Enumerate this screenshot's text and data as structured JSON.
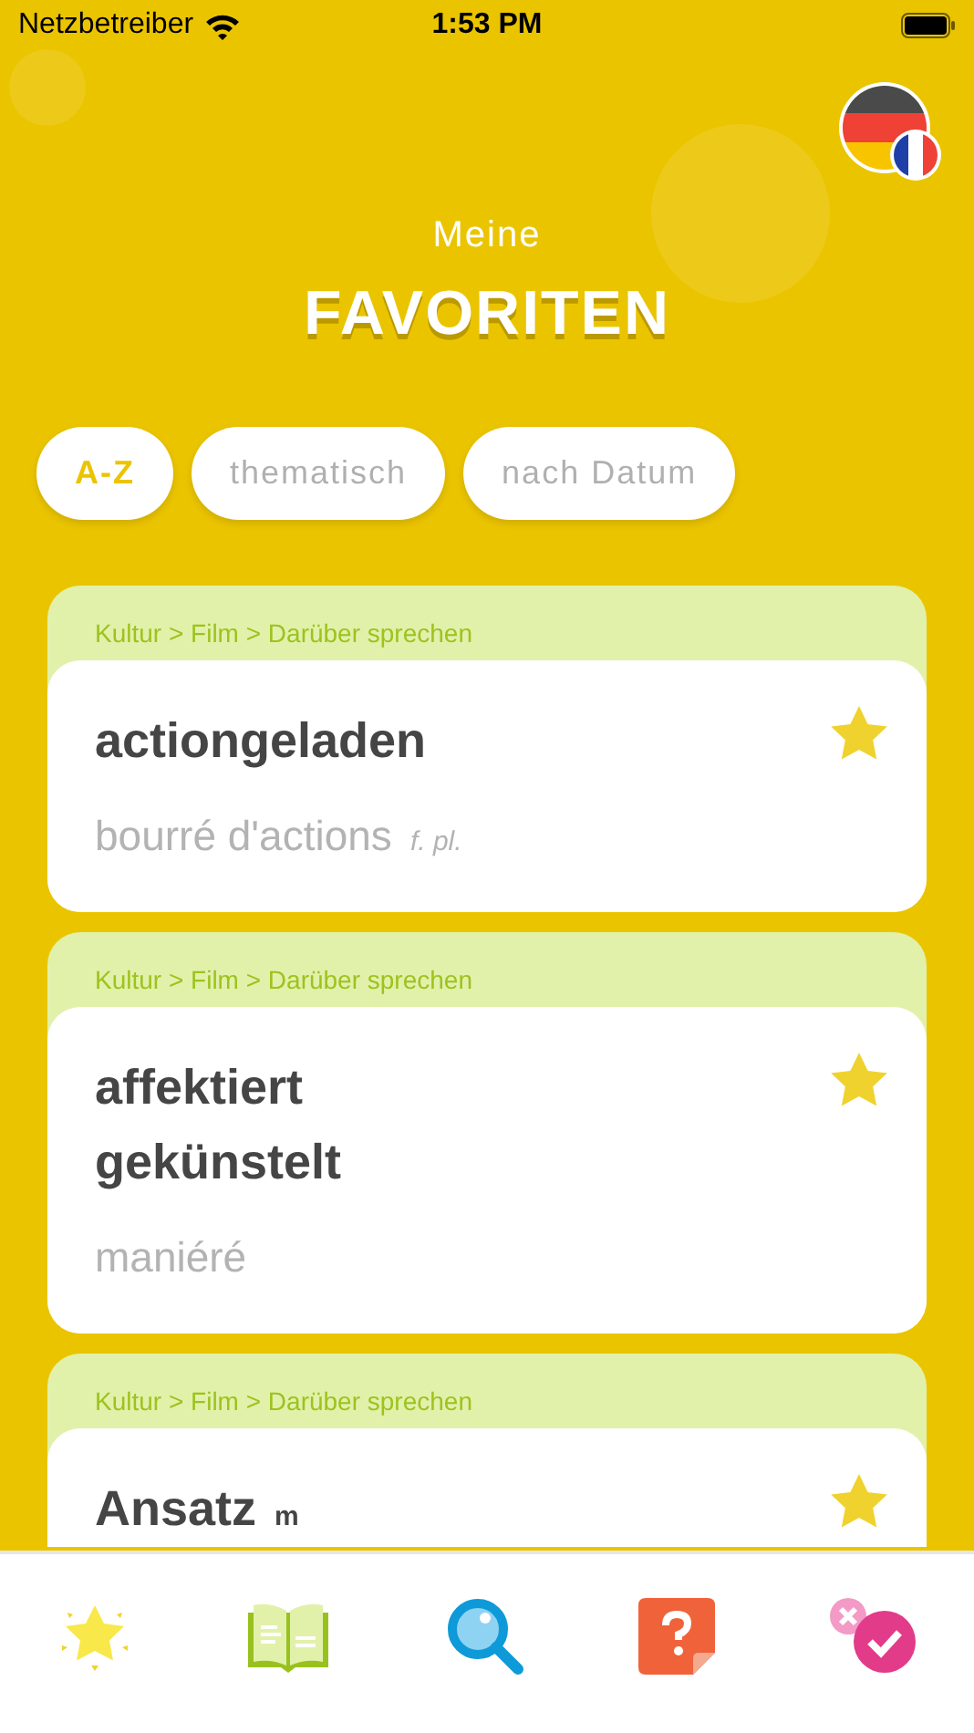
{
  "status_bar": {
    "carrier": "Netzbetreiber",
    "time": "1:53 PM"
  },
  "header": {
    "subtitle": "Meine",
    "title": "FAVORITEN"
  },
  "sort_tabs": [
    {
      "label": "A-Z",
      "selected": true
    },
    {
      "label": "thematisch",
      "selected": false
    },
    {
      "label": "nach Datum",
      "selected": false
    }
  ],
  "entries": [
    {
      "path": "Kultur > Film > Darüber sprechen",
      "terms": [
        "actiongeladen"
      ],
      "translation": "bourré d'actions",
      "translation_gender": "f. pl.",
      "favorite": true
    },
    {
      "path": "Kultur > Film > Darüber sprechen",
      "terms": [
        "affektiert",
        "gekünstelt"
      ],
      "translation": "maniéré",
      "favorite": true
    },
    {
      "path": "Kultur > Film > Darüber sprechen",
      "terms": [
        "Ansatz"
      ],
      "term_gender": "m",
      "favorite": true
    }
  ],
  "tab_bar": [
    {
      "kind": "favorites"
    },
    {
      "kind": "dictionary"
    },
    {
      "kind": "search"
    },
    {
      "kind": "quiz"
    },
    {
      "kind": "test"
    }
  ]
}
